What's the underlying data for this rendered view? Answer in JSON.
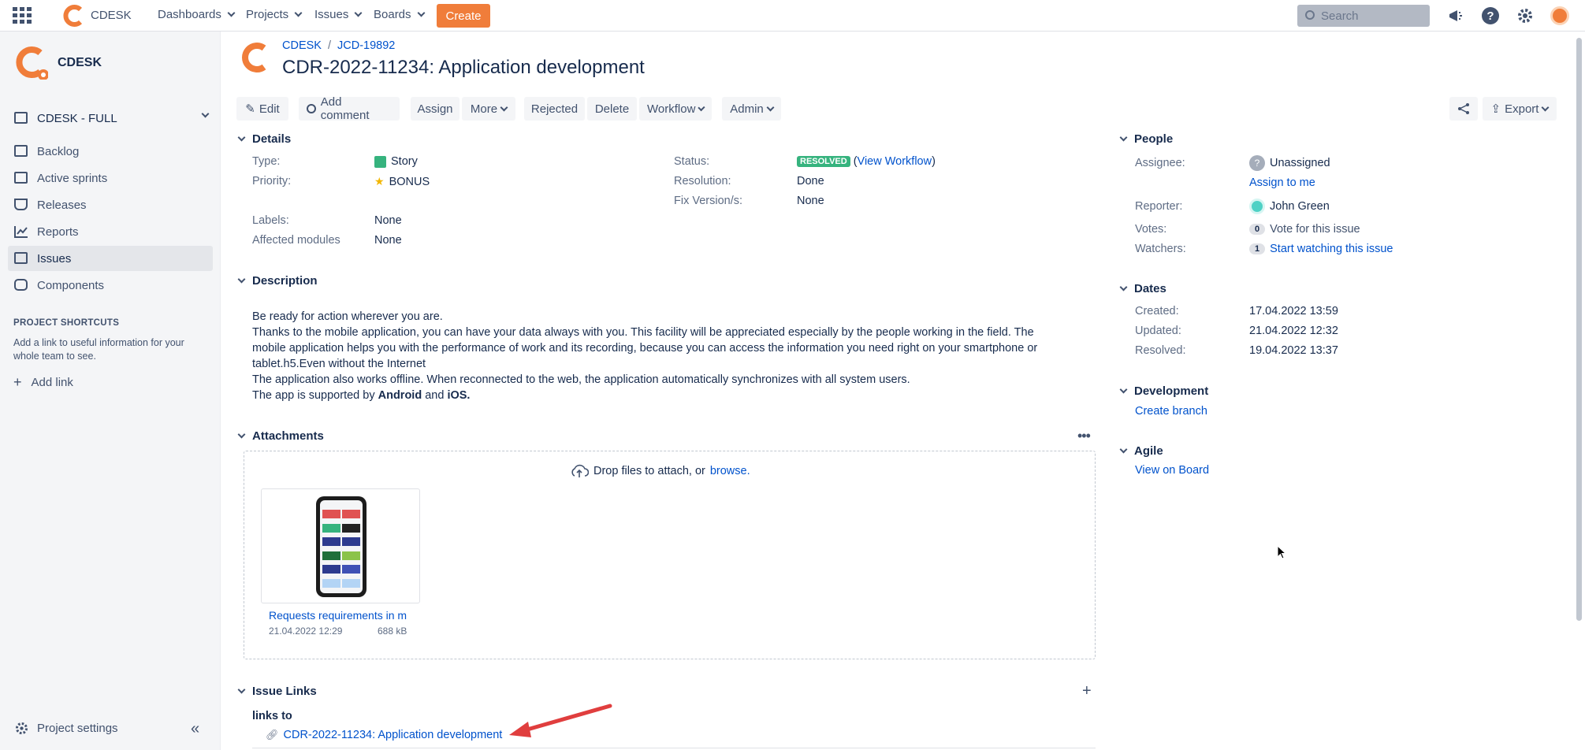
{
  "topnav": {
    "brand": "CDESK",
    "menus": [
      "Dashboards",
      "Projects",
      "Issues",
      "Boards"
    ],
    "create_label": "Create",
    "search_placeholder": "Search"
  },
  "sidebar": {
    "project_name": "CDESK",
    "board_selector": "CDESK - FULL",
    "items": [
      "Backlog",
      "Active sprints",
      "Releases",
      "Reports",
      "Issues",
      "Components"
    ],
    "shortcuts_heading": "PROJECT SHORTCUTS",
    "shortcuts_text_1": "Add a link to useful information for your",
    "shortcuts_text_2": "whole team to see.",
    "add_link": "Add link",
    "settings": "Project settings"
  },
  "breadcrumb": {
    "project": "CDESK",
    "separator": "/",
    "parent": "JCD-19892"
  },
  "issue": {
    "title": "CDR-2022-11234: Application development"
  },
  "toolbar": {
    "edit": "Edit",
    "comment": "Add comment",
    "assign": "Assign",
    "more": "More",
    "rejected": "Rejected",
    "delete": "Delete",
    "workflow": "Workflow",
    "admin": "Admin",
    "export": "Export"
  },
  "details": {
    "heading": "Details",
    "type_label": "Type:",
    "type_value": "Story",
    "priority_label": "Priority:",
    "priority_value": "BONUS",
    "labels_label": "Labels:",
    "labels_value": "None",
    "modules_label": "Affected modules",
    "modules_value": "None",
    "status_label": "Status:",
    "status_value": "RESOLVED",
    "view_workflow": "View Workflow",
    "resolution_label": "Resolution:",
    "resolution_value": "Done",
    "fixversion_label": "Fix Version/s:",
    "fixversion_value": "None"
  },
  "description": {
    "heading": "Description",
    "line1": "Be ready for action wherever you are.",
    "line2": "Thanks to the mobile application, you can have your data always with you. This facility will be appreciated especially by the people working in the field. The",
    "line3": "mobile application helps you with the performance of work and its recording, because you can access the information you need right on your smartphone or",
    "line4": "tablet.h5.Even without the Internet",
    "line5": "The application also works offline. When reconnected to the web, the application automatically synchronizes with all system users.",
    "line6_pre": "The app is supported by",
    "line6_b1": "Android",
    "line6_and": "and",
    "line6_b2": "iOS."
  },
  "attachments": {
    "heading": "Attachments",
    "drop_text": "Drop files to attach, or",
    "browse": "browse.",
    "file_name": "Requests requirements in m",
    "file_date": "21.04.2022 12:29",
    "file_size": "688 kB"
  },
  "issue_links": {
    "heading": "Issue Links",
    "relation": "links to",
    "link": "CDR-2022-11234: Application development"
  },
  "people": {
    "heading": "People",
    "assignee_label": "Assignee:",
    "assignee_value": "Unassigned",
    "assign_to_me": "Assign to me",
    "reporter_label": "Reporter:",
    "reporter_value": "John Green",
    "votes_label": "Votes:",
    "votes_count": "0",
    "votes_text": "Vote for this issue",
    "watchers_label": "Watchers:",
    "watchers_count": "1",
    "watchers_text": "Start watching this issue"
  },
  "dates": {
    "heading": "Dates",
    "created_label": "Created:",
    "created_value": "17.04.2022 13:59",
    "updated_label": "Updated:",
    "updated_value": "21.04.2022 12:32",
    "resolved_label": "Resolved:",
    "resolved_value": "19.04.2022 13:37"
  },
  "development": {
    "heading": "Development",
    "create_branch": "Create branch"
  },
  "agile": {
    "heading": "Agile",
    "view_on_board": "View on Board"
  },
  "colors": {
    "accent": "#f07d3a",
    "link": "#0052cc",
    "resolved": "#36b37e",
    "annotation_arrow": "#e03e3e"
  }
}
